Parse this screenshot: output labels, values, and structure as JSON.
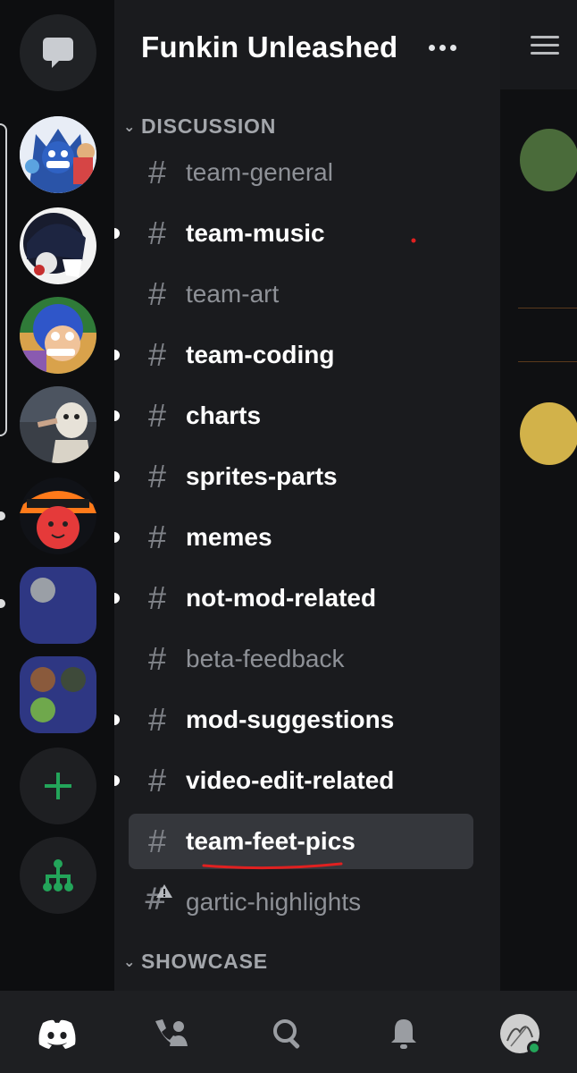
{
  "server": {
    "name": "Funkin Unleashed"
  },
  "categories": [
    {
      "label": "DISCUSSION"
    },
    {
      "label": "SHOWCASE"
    }
  ],
  "channels": [
    {
      "name": "team-general",
      "state": "read"
    },
    {
      "name": "team-music",
      "state": "unread"
    },
    {
      "name": "team-art",
      "state": "read"
    },
    {
      "name": "team-coding",
      "state": "unread"
    },
    {
      "name": "charts",
      "state": "unread"
    },
    {
      "name": "sprites-parts",
      "state": "unread"
    },
    {
      "name": "memes",
      "state": "unread"
    },
    {
      "name": "not-mod-related",
      "state": "unread"
    },
    {
      "name": "beta-feedback",
      "state": "read"
    },
    {
      "name": "mod-suggestions",
      "state": "unread"
    },
    {
      "name": "video-edit-related",
      "state": "unread"
    },
    {
      "name": "team-feet-pics",
      "state": "selected"
    },
    {
      "name": "gartic-highlights",
      "state": "read",
      "icon": "hash-warning-icon"
    }
  ],
  "colors": {
    "accent_green": "#23a55a",
    "selected_bg": "#35373c",
    "folder": "#2e3783",
    "annotation_red": "#e02020"
  },
  "nav": [
    "discord-home-icon",
    "friends-icon",
    "search-icon",
    "notifications-icon",
    "profile-avatar"
  ]
}
